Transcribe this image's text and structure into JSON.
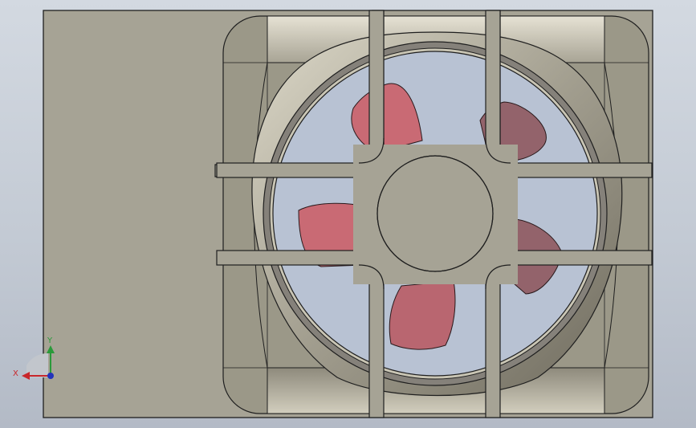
{
  "colors": {
    "housing": "#a6a395",
    "housing_shadow": "#8f8b7c",
    "edge": "#1f1f1f",
    "opening_fill": "#b8c2d3",
    "blade": "#c96a74",
    "blade_dark": "#93636b",
    "triad_x": "#c8262b",
    "triad_y": "#2a9a3a",
    "triad_z": "#2233bb"
  },
  "icons": {
    "triad": "xyz-axis-triad-icon"
  },
  "triad": {
    "x_label": "X",
    "y_label": "Y"
  }
}
